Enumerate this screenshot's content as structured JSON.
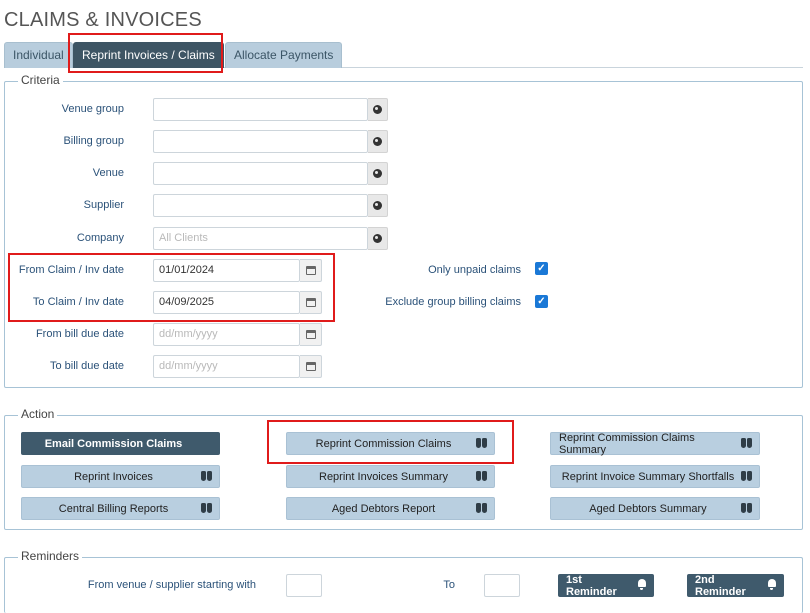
{
  "page": {
    "title": "CLAIMS & INVOICES"
  },
  "tabs": [
    {
      "label": "Individual"
    },
    {
      "label": "Reprint Invoices / Claims",
      "active": true
    },
    {
      "label": "Allocate Payments"
    }
  ],
  "criteria": {
    "legend": "Criteria",
    "venue_group": {
      "label": "Venue group",
      "value": ""
    },
    "billing_group": {
      "label": "Billing group",
      "value": ""
    },
    "venue": {
      "label": "Venue",
      "value": ""
    },
    "supplier": {
      "label": "Supplier",
      "value": ""
    },
    "company": {
      "label": "Company",
      "placeholder": "All Clients"
    },
    "from_claim_date": {
      "label": "From Claim / Inv date",
      "value": "01/01/2024"
    },
    "to_claim_date": {
      "label": "To Claim / Inv date",
      "value": "04/09/2025"
    },
    "from_bill_due": {
      "label": "From bill due date",
      "placeholder": "dd/mm/yyyy"
    },
    "to_bill_due": {
      "label": "To bill due date",
      "placeholder": "dd/mm/yyyy"
    },
    "only_unpaid": {
      "label": "Only unpaid claims",
      "checked": true
    },
    "exclude_group": {
      "label": "Exclude group billing claims",
      "checked": true
    }
  },
  "action": {
    "legend": "Action",
    "email_commission_claims": "Email Commission Claims",
    "reprint_commission_claims": "Reprint Commission Claims",
    "reprint_commission_claims_summary": "Reprint Commission Claims Summary",
    "reprint_invoices": "Reprint Invoices",
    "reprint_invoices_summary": "Reprint Invoices Summary",
    "reprint_invoice_summary_shortfalls": "Reprint Invoice Summary Shortfalls",
    "central_billing_reports": "Central Billing Reports",
    "aged_debtors_report": "Aged Debtors Report",
    "aged_debtors_summary": "Aged Debtors Summary"
  },
  "reminders": {
    "legend": "Reminders",
    "from_label": "From venue / supplier starting with",
    "to_label": "To",
    "from_value": "",
    "to_value": "",
    "first_reminder": "1st Reminder",
    "second_reminder": "2nd Reminder"
  },
  "colors": {
    "highlight": "#e01b1b",
    "active_tab": "#3e5564",
    "button_light": "#b9cfe0",
    "button_dark": "#3f5a6c",
    "checkbox": "#1a78d6"
  }
}
